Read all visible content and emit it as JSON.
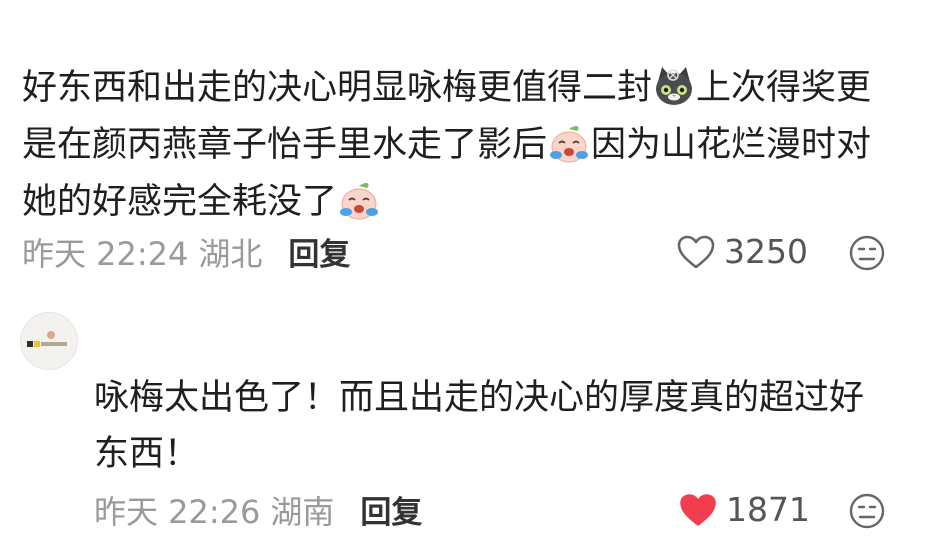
{
  "comments": [
    {
      "username": "",
      "body_segments": [
        "好东西和出走的决心明显咏梅更值得二封",
        "上次得奖更是在颜丙燕章子怡手里水走了影后",
        "因为山花烂漫时对她的好感完全耗没了"
      ],
      "emojis": [
        "cat-emoji",
        "crying-peach-emoji",
        "crying-peach-emoji"
      ],
      "time": "昨天 22:24",
      "location": "湖北",
      "reply_label": "回复",
      "like_count": "3250",
      "liked": false
    },
    {
      "username": "",
      "body": "咏梅太出色了！而且出走的决心的厚度真的超过好东西！",
      "time": "昨天 22:26",
      "location": "湖南",
      "reply_label": "回复",
      "like_count": "1871",
      "liked": true
    }
  ],
  "colors": {
    "liked_heart": "#f23d4f",
    "meta_text": "#9a9a9a",
    "body_text": "#1f1f1f"
  }
}
